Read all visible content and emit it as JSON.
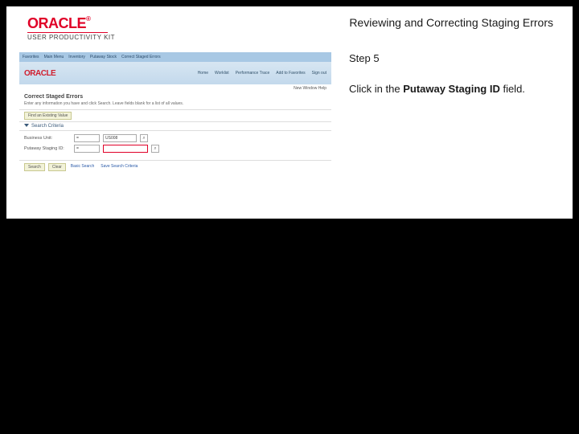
{
  "header": {
    "brand_name": "ORACLE",
    "brand_tm": "®",
    "product_line": "USER PRODUCTIVITY KIT",
    "lesson_title": "Reviewing and Correcting Staging Errors"
  },
  "instruction": {
    "step_label": "Step 5",
    "text_prefix": "Click in the ",
    "field_name": "Putaway Staging ID",
    "text_suffix": " field."
  },
  "screenshot": {
    "nav": {
      "items": [
        "Favorites",
        "Main Menu",
        "Inventory",
        "Putaway Stock",
        "Correct Staged Errors"
      ]
    },
    "brand": "ORACLE",
    "tabs": [
      "Home",
      "Worklist",
      "Performance Trace",
      "Add to Favorites",
      "Sign out"
    ],
    "substatus": "New Window   Help",
    "page_title": "Correct Staged Errors",
    "page_desc": "Enter any information you have and click Search. Leave fields blank for a list of all values.",
    "find_button": "Find an Existing Value",
    "section_label": "Search Criteria",
    "form": {
      "row1": {
        "label": "Business Unit:",
        "op": "=",
        "value": "US008"
      },
      "row2": {
        "label": "Putaway Staging ID:",
        "op": "=",
        "value": ""
      }
    },
    "footer": {
      "search": "Search",
      "clear": "Clear",
      "basic": "Basic Search",
      "save": "Save Search Criteria"
    }
  }
}
